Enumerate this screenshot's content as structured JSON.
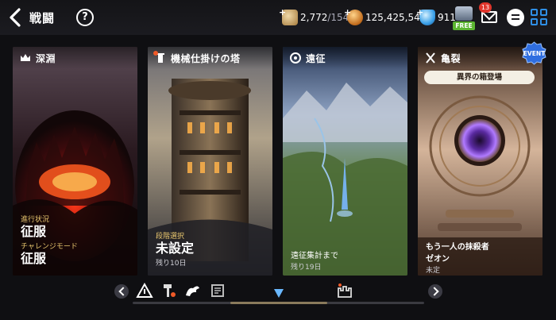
{
  "header": {
    "title": "戦闘",
    "back_icon": "chevron-left-icon",
    "help_label": "?"
  },
  "resources": {
    "stamina": {
      "value": "2,772",
      "max": "/154",
      "icon": "scroll-stamina-icon"
    },
    "gold": {
      "value": "125,425,540",
      "icon": "gold-coin-icon"
    },
    "gems": {
      "value": "911",
      "icon": "crystal-gem-icon"
    }
  },
  "top_actions": {
    "free_label": "FREE",
    "mail_badge": "13"
  },
  "cards": [
    {
      "title": "深淵",
      "icon": "abyss-icon",
      "lines": [
        {
          "label": "進行状況",
          "value": "征服"
        },
        {
          "label": "チャレンジモード",
          "value": "征服"
        }
      ]
    },
    {
      "title": "機械仕掛けの塔",
      "icon": "tower-icon",
      "label": "段階選択",
      "value": "未設定",
      "sub": "残り10日"
    },
    {
      "title": "遠征",
      "icon": "expedition-icon",
      "label": "遠征集計まで",
      "sub": "残り19日"
    },
    {
      "title": "亀裂",
      "icon": "rift-icon",
      "event": "EVENT",
      "pill": "異界の箱登場",
      "label": "もう一人の抹殺者",
      "label2": "ゼオン",
      "sub": "未定"
    }
  ],
  "bottom_nav": {
    "icons": [
      "warning-triangle-icon",
      "hammer-icon",
      "dragon-icon",
      "scroll-map-icon",
      "crystal-marker-icon",
      "castle-icon"
    ],
    "scroll_position": 0.5,
    "colors": {
      "track": "#3a3a40",
      "thumb": "#8a7a5c"
    }
  },
  "colors": {
    "accent_gold": "#e8c66e",
    "badge_red": "#e0352b",
    "event_blue": "#2f8fe6",
    "free_green": "#5cb531"
  }
}
